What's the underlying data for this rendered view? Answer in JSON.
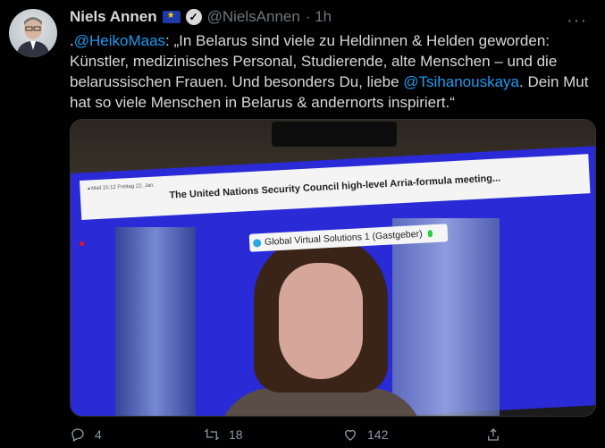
{
  "author": {
    "name": "Niels Annen",
    "handle": "@NielsAnnen",
    "time": "· 1h"
  },
  "tweet": {
    "prefix": ".",
    "mention1": "@HeikoMaas",
    "text1": ": „In Belarus sind viele zu Heldinnen & Helden geworden: Künstler, medizinisches Personal, Studierende, alte Menschen – und die belarussischen Frauen. Und besonders Du, liebe ",
    "mention2": "@Tsihanouskaya",
    "text2": ". Dein Mut hat so viele Menschen in Belarus & andernorts inspiriert.“"
  },
  "media": {
    "screen_title": "The United Nations Security Council high-level Arria-formula meeting...",
    "status_small": "◂ Mail  15:12  Freitag 22. Jan.",
    "participant_label": "Global Virtual Solutions 1 (Gastgeber)"
  },
  "actions": {
    "replies": "4",
    "retweets": "18",
    "likes": "142"
  },
  "icons": {
    "more": "more-icon",
    "reply": "reply-icon",
    "retweet": "retweet-icon",
    "like": "like-icon",
    "share": "share-icon"
  }
}
